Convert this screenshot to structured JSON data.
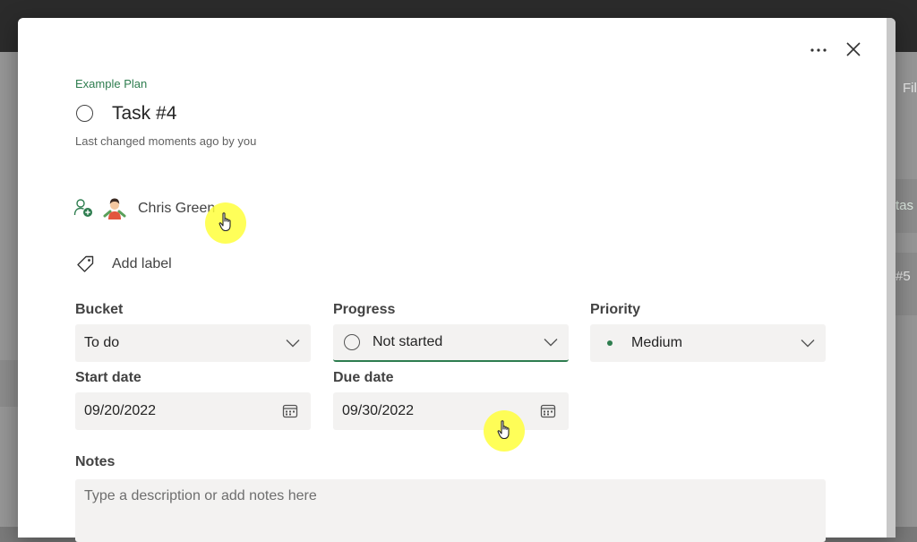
{
  "background": {
    "fragments": [
      "Fil",
      "tas",
      "#5"
    ]
  },
  "header": {
    "more_icon": "more-horizontal-icon",
    "close_icon": "close-icon"
  },
  "task": {
    "plan_name": "Example Plan",
    "title": "Task #4",
    "last_changed": "Last changed moments ago by you"
  },
  "assignment": {
    "assignee_name": "Chris Green",
    "add_label": "Add label"
  },
  "fields": {
    "bucket": {
      "label": "Bucket",
      "value": "To do"
    },
    "progress": {
      "label": "Progress",
      "value": "Not started"
    },
    "priority": {
      "label": "Priority",
      "value": "Medium"
    },
    "start_date": {
      "label": "Start date",
      "value": "09/20/2022"
    },
    "due_date": {
      "label": "Due date",
      "value": "09/30/2022"
    }
  },
  "notes": {
    "label": "Notes",
    "placeholder": "Type a description or add notes here"
  },
  "colors": {
    "accent": "#2e7d4f",
    "cursor_highlight": "#ffff3c"
  }
}
